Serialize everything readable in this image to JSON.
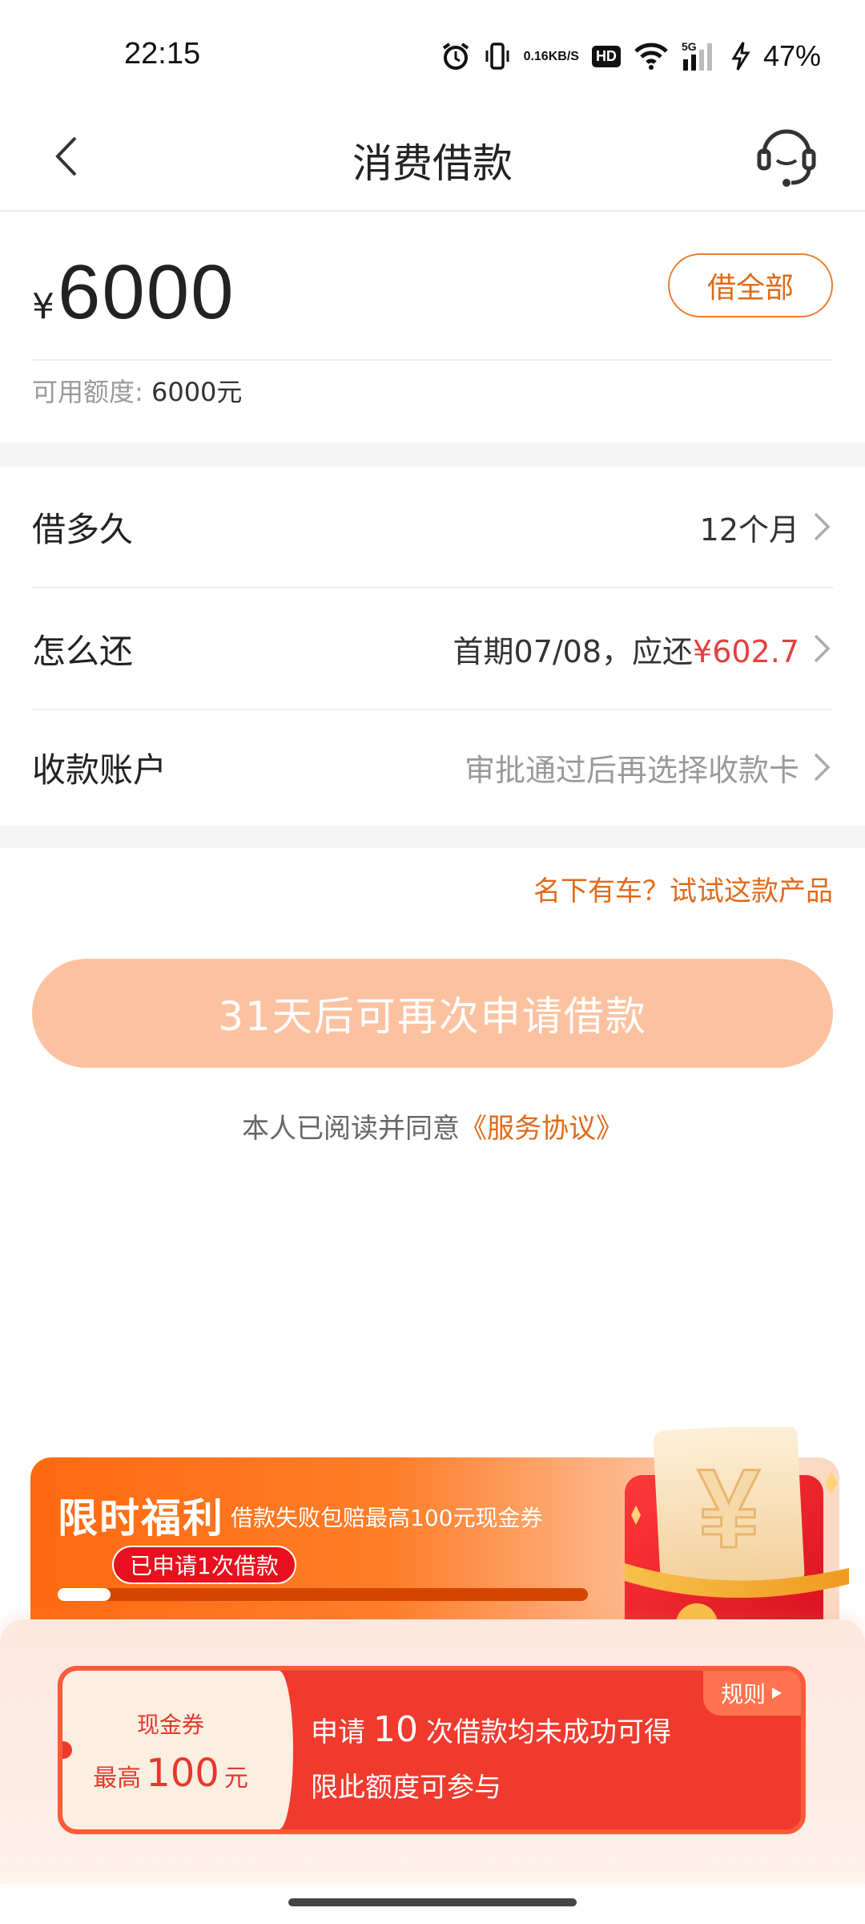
{
  "status_bar": {
    "time": "22:15",
    "net_speed_value": "0.16",
    "net_speed_unit": "KB/S",
    "hd": "HD",
    "signal": "5G",
    "battery": "47%"
  },
  "nav": {
    "title": "消费借款"
  },
  "amount": {
    "currency": "¥",
    "value": "6000",
    "borrow_all_label": "借全部",
    "available_label": "可用额度:",
    "available_value": "6000元"
  },
  "options": [
    {
      "label": "借多久",
      "value": "12个月"
    },
    {
      "label": "怎么还",
      "value_prefix": "首期07/08，应还",
      "value_amount": "¥602.7"
    },
    {
      "label": "收款账户",
      "value": "审批通过后再选择收款卡"
    }
  ],
  "tip_link": "名下有车？试试这款产品",
  "apply_button": "31天后可再次申请借款",
  "agreement": {
    "text": "本人已阅读并同意",
    "link": "《服务协议》"
  },
  "promo": {
    "title": "限时福利",
    "subtitle": "借款失败包赔最高100元现金券",
    "badge": "已申请1次借款",
    "progress_fraction": 0.1,
    "envelope_symbol": "¥"
  },
  "coupon": {
    "label": "现金券",
    "value_prefix": "最高",
    "value_number": "100",
    "value_unit": "元",
    "rule_label": "规则",
    "line1_prefix": "申请",
    "line1_count": "10",
    "line1_suffix": "次借款均未成功可得",
    "line2": "限此额度可参与"
  },
  "colors": {
    "accent": "#e06a1a",
    "apply_button_bg": "#fcc2a0",
    "amount_red": "#e34040",
    "coupon_red": "#f03a2e"
  },
  "icons": {
    "back": "chevron-left-icon",
    "service": "headset-icon",
    "row_arrow": "chevron-right-icon"
  }
}
